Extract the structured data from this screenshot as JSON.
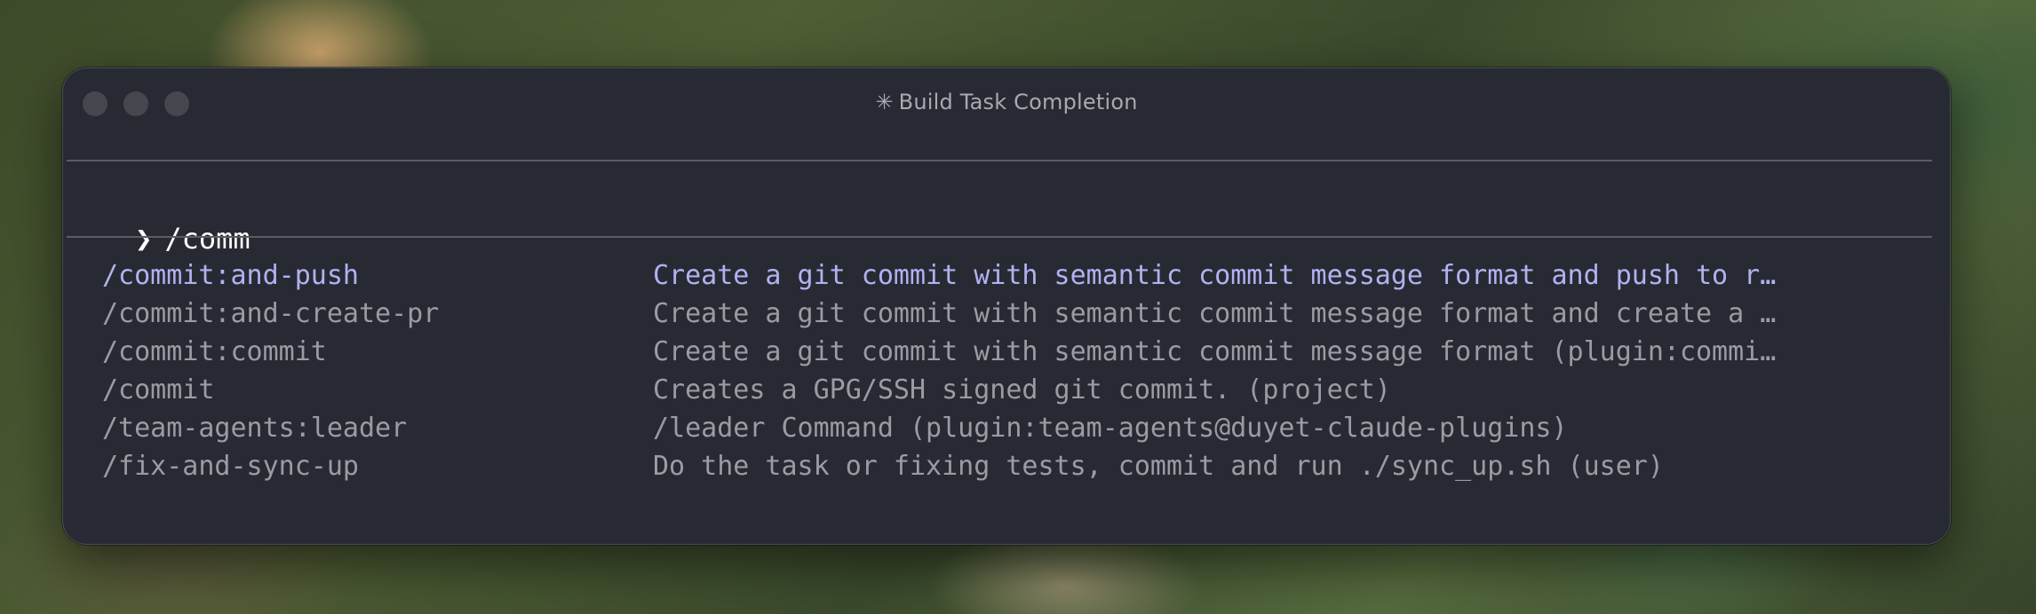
{
  "window": {
    "title": "Build Task Completion",
    "title_icon": "✳"
  },
  "prompt": {
    "symbol": "❯",
    "value": "/comm"
  },
  "suggestions": [
    {
      "command": "/commit:and-push",
      "description": "Create a git commit with semantic commit message format and push to r…",
      "selected": true
    },
    {
      "command": "/commit:and-create-pr",
      "description": "Create a git commit with semantic commit message format and create a …",
      "selected": false
    },
    {
      "command": "/commit:commit",
      "description": "Create a git commit with semantic commit message format (plugin:commi…",
      "selected": false
    },
    {
      "command": "/commit",
      "description": "Creates a GPG/SSH signed git commit. (project)",
      "selected": false
    },
    {
      "command": "/team-agents:leader",
      "description": "/leader Command (plugin:team-agents@duyet-claude-plugins)",
      "selected": false
    },
    {
      "command": "/fix-and-sync-up",
      "description": "Do the task or fixing tests, commit and run ./sync_up.sh (user)",
      "selected": false
    }
  ],
  "colors": {
    "window_bg": "#282a33",
    "selected_text": "#b4b0f2",
    "normal_text": "#9a9ca4",
    "prompt_text": "#ffffff"
  }
}
